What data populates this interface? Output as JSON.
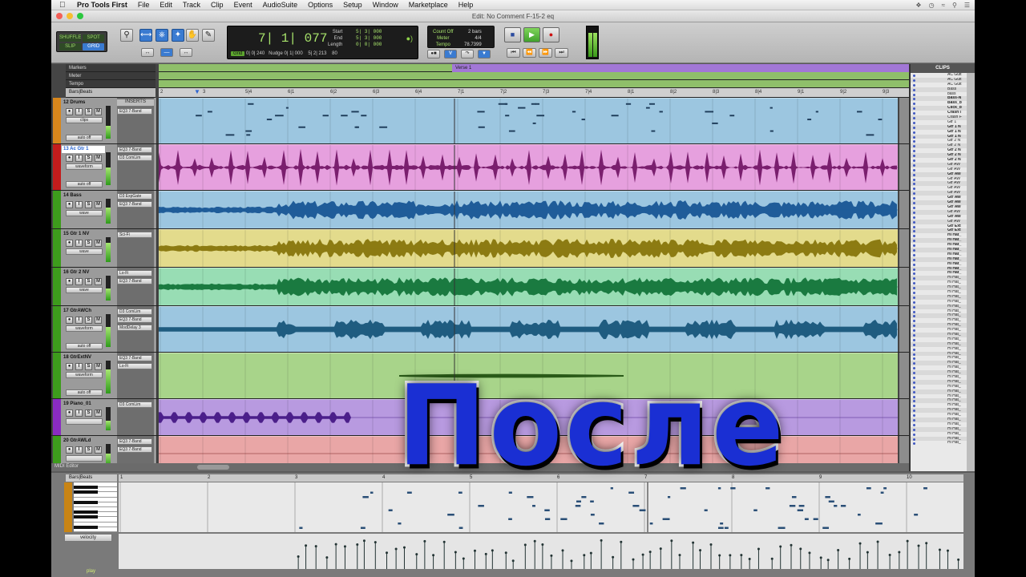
{
  "menubar": {
    "app_name": "Pro Tools First",
    "items": [
      "File",
      "Edit",
      "Track",
      "Clip",
      "Event",
      "AudioSuite",
      "Options",
      "Setup",
      "Window",
      "Marketplace",
      "Help"
    ]
  },
  "window": {
    "title": "Edit: No Comment F-15-2 eq"
  },
  "toolbar": {
    "modes": [
      "SHUFFLE",
      "SPOT",
      "SLIP",
      "GRID"
    ],
    "main_counter": "7| 1| 077",
    "start_label": "Start",
    "end_label": "End",
    "length_label": "Length",
    "start": "5| 3| 000",
    "end": "5| 3| 000",
    "length": "0| 0| 000",
    "grid_label": "Grid",
    "grid_value": "0| 0| 240",
    "nudge_label": "Nudge",
    "nudge_value": "0| 1| 000",
    "cursor_value": "5| 2| 213",
    "zoom_value": "80",
    "count_off": "Count Off",
    "count_bars": "2 bars",
    "meter_label": "Meter",
    "meter_value": "4/4",
    "tempo_label": "Tempo",
    "tempo_value": "78.7399"
  },
  "rulers": {
    "markers": "Markers",
    "meter": "Meter",
    "tempo": "Tempo",
    "bars": "Bars|Beats",
    "marker_name": "Verse 1",
    "bar_ticks": [
      "2",
      "3",
      "5|4",
      "6|1",
      "6|2",
      "6|3",
      "6|4",
      "7|1",
      "7|2",
      "7|3",
      "7|4",
      "8|1",
      "8|2",
      "8|3",
      "8|4",
      "9|1",
      "9|2",
      "9|3"
    ]
  },
  "inserts_header": "INSERTS",
  "tracks": [
    {
      "num": "12",
      "name": "Drums",
      "mode": "clips",
      "mode2": "none",
      "auto": "auto off",
      "inserts": [
        "Xpand!2",
        "EQ3 7-Band"
      ],
      "color": "#d7861c"
    },
    {
      "num": "13",
      "name": "Ac Gtr 1",
      "mode": "waveform",
      "auto": "auto off",
      "inserts": [
        "EQ3 7-Band",
        "D3 ComLim"
      ],
      "color": "#c31c1c"
    },
    {
      "num": "14",
      "name": "Bass",
      "mode": "wave",
      "auto": "off",
      "inserts": [
        "D3 ExpGate",
        "EQ3 7-Band"
      ],
      "color": "#3d9c1c"
    },
    {
      "num": "15",
      "name": "Gtr 1 NV",
      "mode": "wave",
      "auto": "off",
      "inserts": [
        "Sci-Fi"
      ],
      "color": "#3d9c1c"
    },
    {
      "num": "16",
      "name": "Gtr 2 NV",
      "mode": "wave",
      "auto": "off",
      "inserts": [
        "Lo-Fi",
        "EQ3 7-Band"
      ],
      "color": "#3d9c1c"
    },
    {
      "num": "17",
      "name": "GtrAWCh",
      "mode": "waveform",
      "auto": "auto off",
      "inserts": [
        "D3 ComLim",
        "EQ3 7-Band",
        "ModDelay 3"
      ],
      "color": "#3d9c1c"
    },
    {
      "num": "18",
      "name": "GtrExtNV",
      "mode": "waveform",
      "auto": "auto off",
      "inserts": [
        "EQ3 7-Band",
        "Lo-Fi"
      ],
      "color": "#3d9c1c"
    },
    {
      "num": "19",
      "name": "Piano_01",
      "mode": "",
      "auto": "",
      "inserts": [
        "D3 ComLim"
      ],
      "color": "#8a2bc2"
    },
    {
      "num": "20",
      "name": "GtrAWLd",
      "mode": "",
      "auto": "",
      "inserts": [
        "EQ3 7-Band",
        "EQ3 7-Band"
      ],
      "color": "#3d9c1c"
    }
  ],
  "clips_panel": {
    "title": "CLIPS",
    "items": [
      "AC Guit",
      "AC Guit",
      "AC Guit",
      "Bass",
      "bass",
      "Bass-N",
      "Bass_b",
      "Click_b",
      "Crash I",
      "Crash F",
      "Gtr 1",
      "Gtr 1 N",
      "Gtr 1 N",
      "Gtr 1 N",
      "Gtr 2 N",
      "Gtr 2 N",
      "Gtr 2 N",
      "Gtr 2 N",
      "Gtr 2 N",
      "Gtr AW",
      "Gtr AW",
      "Gtr AW",
      "Gtr AW",
      "Gtr AW",
      "Gtr AW",
      "Gtr AW",
      "Gtr AW",
      "Gtr AW",
      "Gtr AW",
      "Gtr AW",
      "Gtr AW",
      "Gtr AW",
      "Gtr Ext",
      "Gtr Ext",
      "Hi Hat_",
      "Hi Hat_",
      "Hi Hat_",
      "Hi Hat_",
      "Hi Hat_",
      "Hi Hat_",
      "Hi Hat_",
      "Hi Hat_",
      "Hi Hat_",
      "Hi Hat_",
      "Hi Hat_",
      "Hi Hat_",
      "Hi Hat_",
      "Hi Hat_",
      "Hi Hat_",
      "Hi Hat_",
      "Hi Hat_",
      "Hi Hat_",
      "Hi Hat_",
      "Hi Hat_",
      "Hi Hat_",
      "Hi Hat_",
      "Hi Hat_",
      "Hi Hat_",
      "Hi Hat_",
      "Hi Hat_",
      "Hi Hat_",
      "Hi Hat_",
      "Hi Hat_",
      "Hi Hat_",
      "Hi Hat_",
      "Hi Hat_",
      "Hi Hat_",
      "Hi Hat_",
      "Hi Hat_",
      "Hi Hat_",
      "Hi Hat_",
      "Hi Hat_",
      "Hi Hat_",
      "Hi Hat_",
      "Hi Hat_",
      "Hi Hat_",
      "Hi Hat_",
      "Hi Hat_",
      "Hi Hat_"
    ],
    "bold_indices": [
      5,
      6,
      7,
      8,
      11,
      12,
      13,
      16,
      17,
      18,
      21,
      26,
      27,
      28,
      30,
      32,
      33,
      34,
      35,
      36,
      37,
      38,
      39,
      40,
      41,
      42
    ]
  },
  "midi_editor": {
    "label": "MIDI Editor",
    "ruler_label": "Bars|Beats",
    "ruler_ticks": [
      "1",
      "2",
      "3",
      "4",
      "5",
      "6",
      "7",
      "8",
      "9",
      "10"
    ],
    "lane_label": "velocity",
    "play_label": "play"
  },
  "overlay": {
    "caption": "После"
  },
  "colors": {
    "accent": "#3a7bd1",
    "counter_green": "#a6e16a",
    "caption_fill": "#1a2fd3"
  }
}
